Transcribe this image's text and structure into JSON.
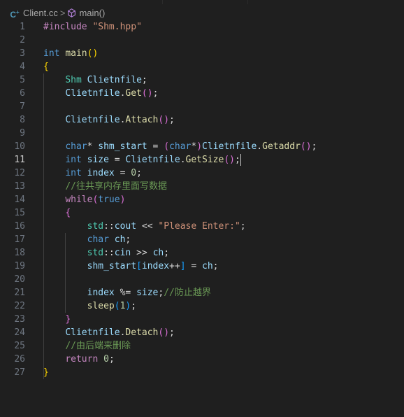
{
  "breadcrumb": {
    "file_icon": "cpp-file-icon",
    "file": "Client.cc",
    "separator": ">",
    "symbol_icon": "method-icon",
    "symbol": "main()"
  },
  "active_line": 11,
  "lines": [
    {
      "n": "1",
      "tokens": [
        {
          "t": "#include ",
          "c": "pre"
        },
        {
          "t": "\"Shm.hpp\"",
          "c": "str"
        }
      ]
    },
    {
      "n": "2",
      "tokens": []
    },
    {
      "n": "3",
      "tokens": [
        {
          "t": "int ",
          "c": "kw"
        },
        {
          "t": "main",
          "c": "fn"
        },
        {
          "t": "()",
          "c": "br1"
        }
      ]
    },
    {
      "n": "4",
      "tokens": [
        {
          "t": "{",
          "c": "br1"
        }
      ]
    },
    {
      "n": "5",
      "tokens": [
        {
          "t": "    "
        },
        {
          "t": "Shm ",
          "c": "type"
        },
        {
          "t": "Clietnfile",
          "c": "var"
        },
        {
          "t": ";",
          "c": "plain"
        }
      ]
    },
    {
      "n": "6",
      "tokens": [
        {
          "t": "    "
        },
        {
          "t": "Clietnfile",
          "c": "var"
        },
        {
          "t": ".",
          "c": "plain"
        },
        {
          "t": "Get",
          "c": "fn"
        },
        {
          "t": "()",
          "c": "br2"
        },
        {
          "t": ";",
          "c": "plain"
        }
      ]
    },
    {
      "n": "7",
      "tokens": []
    },
    {
      "n": "8",
      "tokens": [
        {
          "t": "    "
        },
        {
          "t": "Clietnfile",
          "c": "var"
        },
        {
          "t": ".",
          "c": "plain"
        },
        {
          "t": "Attach",
          "c": "fn"
        },
        {
          "t": "()",
          "c": "br2"
        },
        {
          "t": ";",
          "c": "plain"
        }
      ]
    },
    {
      "n": "9",
      "tokens": []
    },
    {
      "n": "10",
      "tokens": [
        {
          "t": "    "
        },
        {
          "t": "char",
          "c": "kw"
        },
        {
          "t": "* ",
          "c": "plain"
        },
        {
          "t": "shm_start",
          "c": "var"
        },
        {
          "t": " = ",
          "c": "plain"
        },
        {
          "t": "(",
          "c": "br2"
        },
        {
          "t": "char",
          "c": "kw"
        },
        {
          "t": "*",
          "c": "plain"
        },
        {
          "t": ")",
          "c": "br2"
        },
        {
          "t": "Clietnfile",
          "c": "var"
        },
        {
          "t": ".",
          "c": "plain"
        },
        {
          "t": "Getaddr",
          "c": "fn"
        },
        {
          "t": "()",
          "c": "br2"
        },
        {
          "t": ";",
          "c": "plain"
        }
      ]
    },
    {
      "n": "11",
      "tokens": [
        {
          "t": "    "
        },
        {
          "t": "int ",
          "c": "kw"
        },
        {
          "t": "size",
          "c": "var"
        },
        {
          "t": " = ",
          "c": "plain"
        },
        {
          "t": "Clietnfile",
          "c": "var"
        },
        {
          "t": ".",
          "c": "plain"
        },
        {
          "t": "GetSize",
          "c": "fn"
        },
        {
          "t": "()",
          "c": "br2"
        },
        {
          "t": ";",
          "c": "plain"
        }
      ],
      "cursor": true
    },
    {
      "n": "12",
      "tokens": [
        {
          "t": "    "
        },
        {
          "t": "int ",
          "c": "kw"
        },
        {
          "t": "index",
          "c": "var"
        },
        {
          "t": " = ",
          "c": "plain"
        },
        {
          "t": "0",
          "c": "num"
        },
        {
          "t": ";",
          "c": "plain"
        }
      ]
    },
    {
      "n": "13",
      "tokens": [
        {
          "t": "    "
        },
        {
          "t": "//往共享内存里面写数据",
          "c": "com"
        }
      ]
    },
    {
      "n": "14",
      "tokens": [
        {
          "t": "    "
        },
        {
          "t": "while",
          "c": "ctrl"
        },
        {
          "t": "(",
          "c": "br2"
        },
        {
          "t": "true",
          "c": "kw"
        },
        {
          "t": ")",
          "c": "br2"
        }
      ]
    },
    {
      "n": "15",
      "tokens": [
        {
          "t": "    "
        },
        {
          "t": "{",
          "c": "br2"
        }
      ]
    },
    {
      "n": "16",
      "tokens": [
        {
          "t": "        "
        },
        {
          "t": "std",
          "c": "type"
        },
        {
          "t": "::",
          "c": "plain"
        },
        {
          "t": "cout",
          "c": "var"
        },
        {
          "t": " << ",
          "c": "plain"
        },
        {
          "t": "\"Please Enter:\"",
          "c": "str"
        },
        {
          "t": ";",
          "c": "plain"
        }
      ]
    },
    {
      "n": "17",
      "tokens": [
        {
          "t": "        "
        },
        {
          "t": "char ",
          "c": "kw"
        },
        {
          "t": "ch",
          "c": "var"
        },
        {
          "t": ";",
          "c": "plain"
        }
      ]
    },
    {
      "n": "18",
      "tokens": [
        {
          "t": "        "
        },
        {
          "t": "std",
          "c": "type"
        },
        {
          "t": "::",
          "c": "plain"
        },
        {
          "t": "cin",
          "c": "var"
        },
        {
          "t": " >> ",
          "c": "plain"
        },
        {
          "t": "ch",
          "c": "var"
        },
        {
          "t": ";",
          "c": "plain"
        }
      ]
    },
    {
      "n": "19",
      "tokens": [
        {
          "t": "        "
        },
        {
          "t": "shm_start",
          "c": "var"
        },
        {
          "t": "[",
          "c": "br3"
        },
        {
          "t": "index",
          "c": "var"
        },
        {
          "t": "++",
          "c": "plain"
        },
        {
          "t": "]",
          "c": "br3"
        },
        {
          "t": " = ",
          "c": "plain"
        },
        {
          "t": "ch",
          "c": "var"
        },
        {
          "t": ";",
          "c": "plain"
        }
      ]
    },
    {
      "n": "20",
      "tokens": []
    },
    {
      "n": "21",
      "tokens": [
        {
          "t": "        "
        },
        {
          "t": "index",
          "c": "var"
        },
        {
          "t": " %= ",
          "c": "plain"
        },
        {
          "t": "size",
          "c": "var"
        },
        {
          "t": ";",
          "c": "plain"
        },
        {
          "t": "//防止越界",
          "c": "com"
        }
      ]
    },
    {
      "n": "22",
      "tokens": [
        {
          "t": "        "
        },
        {
          "t": "sleep",
          "c": "fn"
        },
        {
          "t": "(",
          "c": "br3"
        },
        {
          "t": "1",
          "c": "num"
        },
        {
          "t": ")",
          "c": "br3"
        },
        {
          "t": ";",
          "c": "plain"
        }
      ]
    },
    {
      "n": "23",
      "tokens": [
        {
          "t": "    "
        },
        {
          "t": "}",
          "c": "br2"
        }
      ]
    },
    {
      "n": "24",
      "tokens": [
        {
          "t": "    "
        },
        {
          "t": "Clietnfile",
          "c": "var"
        },
        {
          "t": ".",
          "c": "plain"
        },
        {
          "t": "Detach",
          "c": "fn"
        },
        {
          "t": "()",
          "c": "br2"
        },
        {
          "t": ";",
          "c": "plain"
        }
      ]
    },
    {
      "n": "25",
      "tokens": [
        {
          "t": "    "
        },
        {
          "t": "//由后端来删除",
          "c": "com"
        }
      ]
    },
    {
      "n": "26",
      "tokens": [
        {
          "t": "    "
        },
        {
          "t": "return ",
          "c": "ctrl"
        },
        {
          "t": "0",
          "c": "num"
        },
        {
          "t": ";",
          "c": "plain"
        }
      ]
    },
    {
      "n": "27",
      "tokens": [
        {
          "t": "}",
          "c": "br1"
        }
      ]
    }
  ]
}
